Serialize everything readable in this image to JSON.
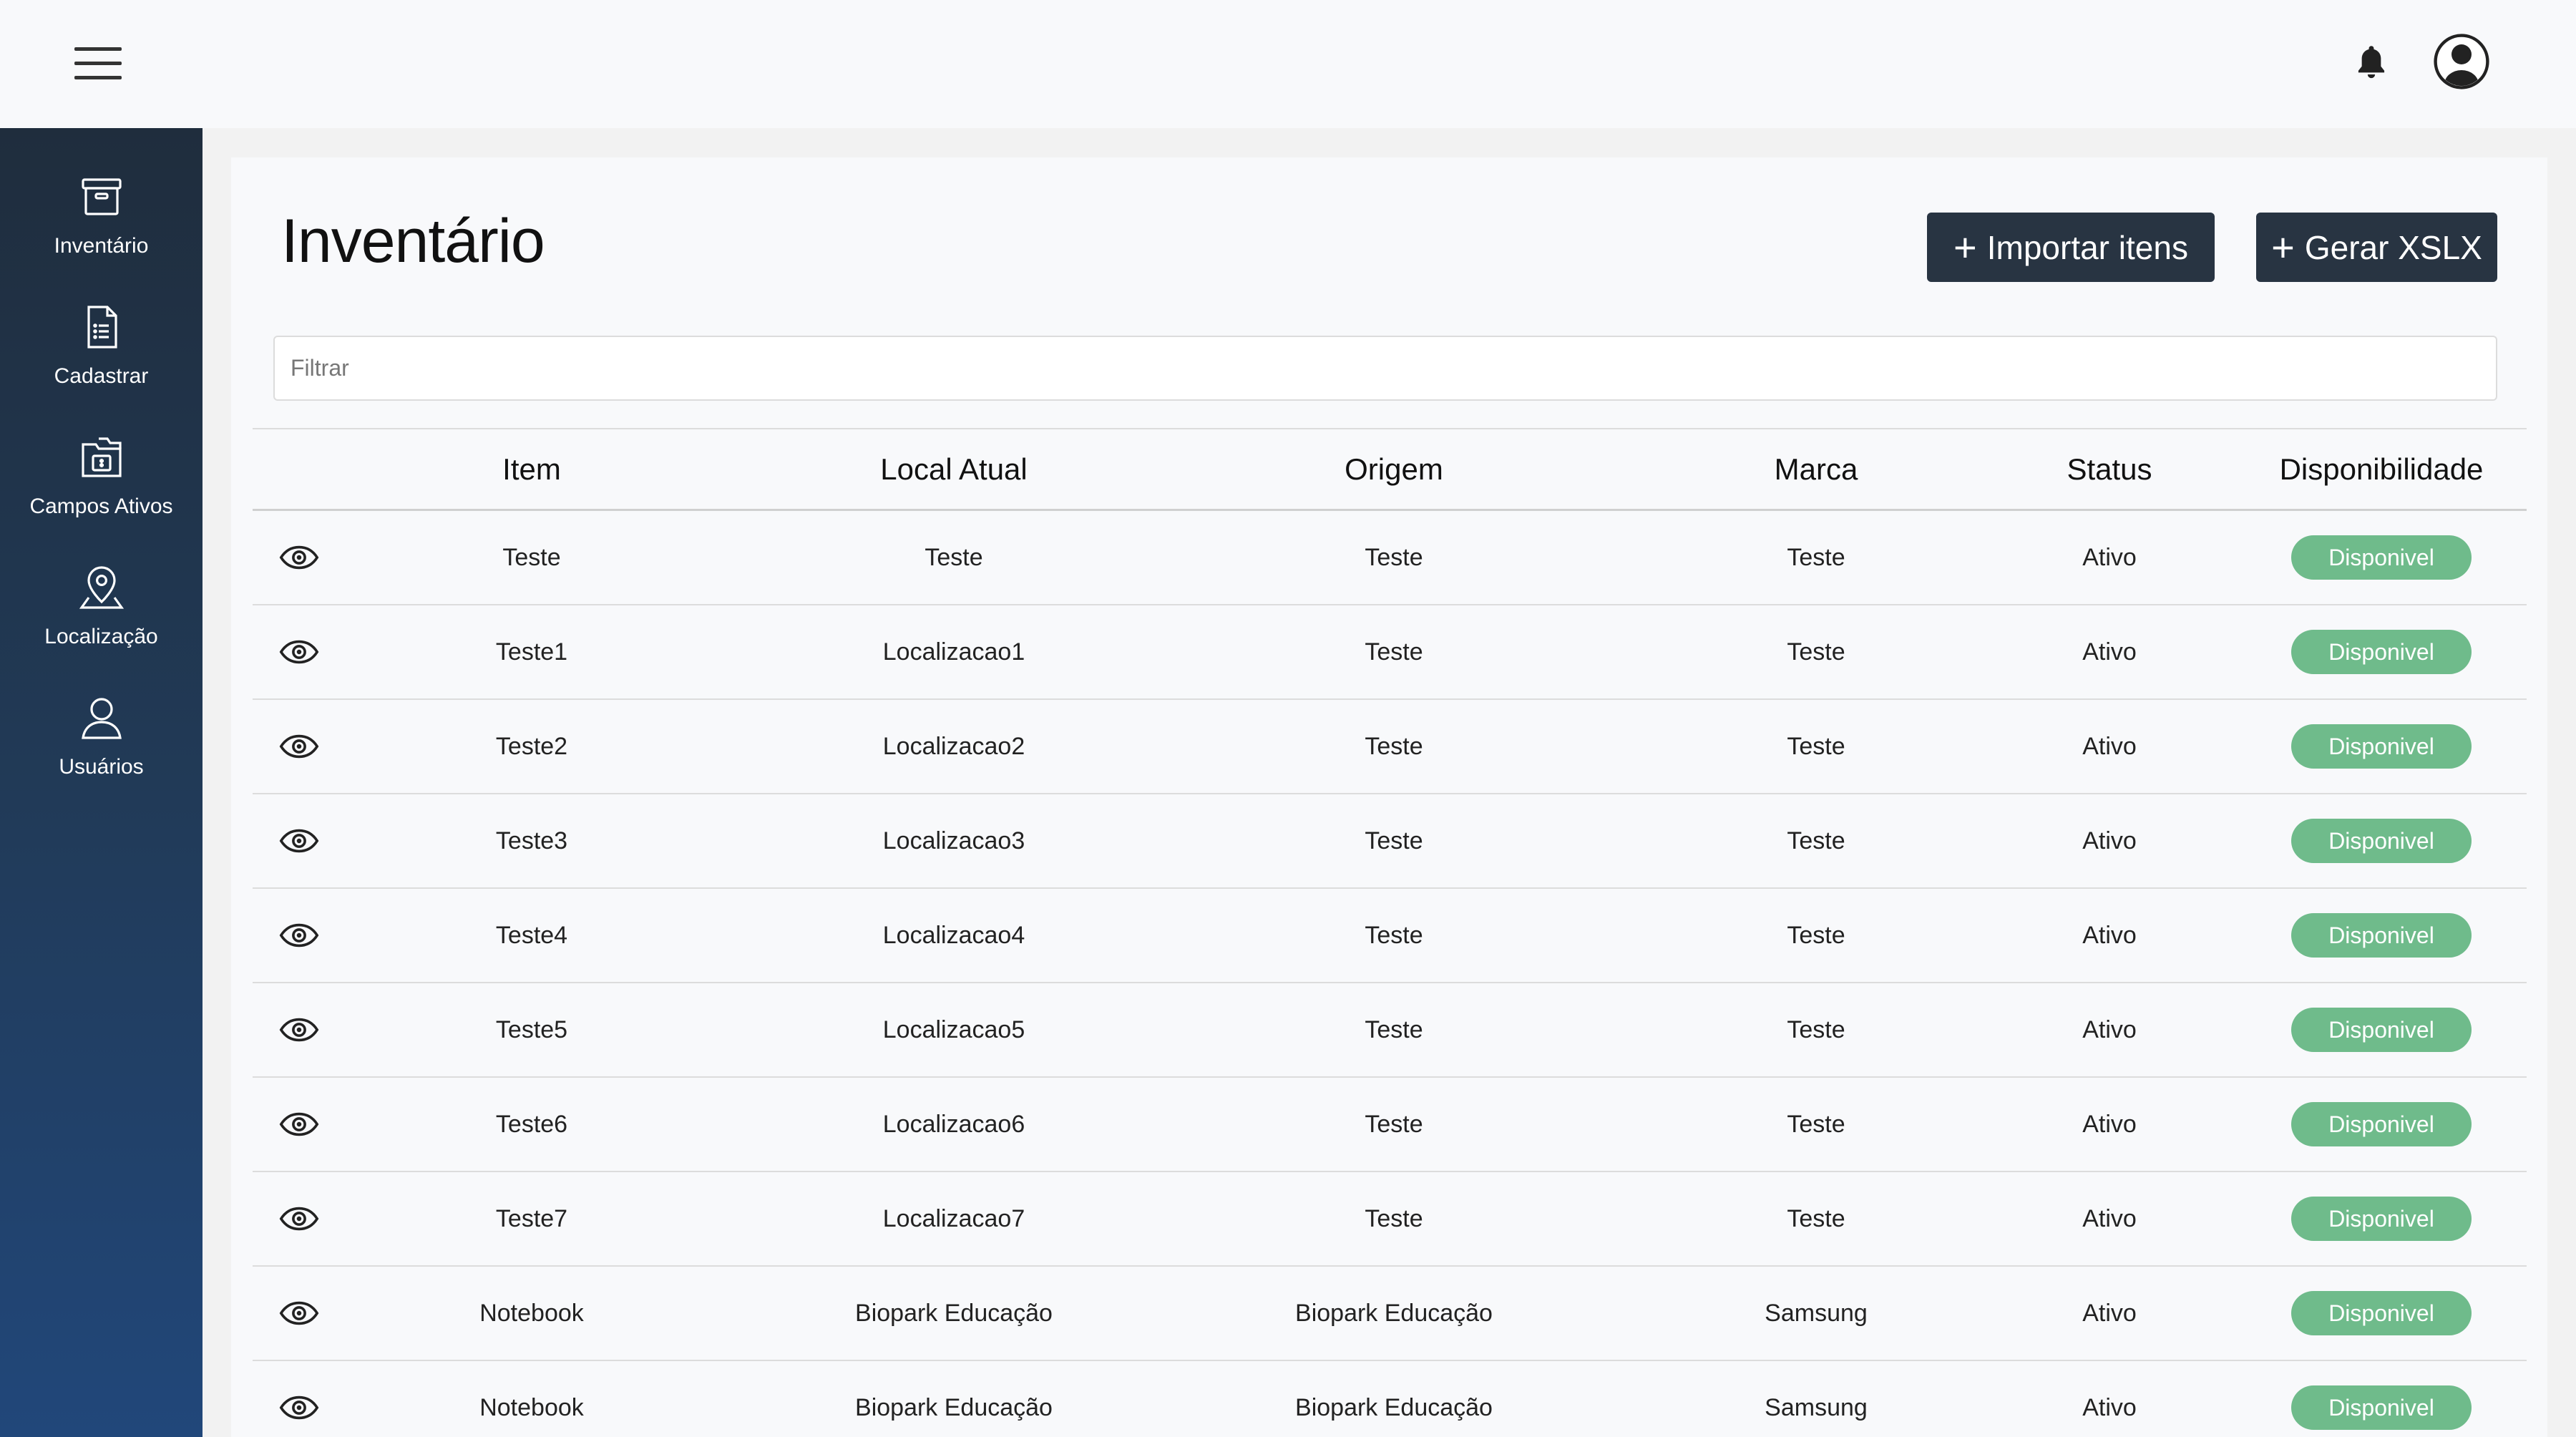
{
  "header": {
    "menu_icon": "hamburger-icon",
    "notification_icon": "bell-icon",
    "avatar_icon": "user-avatar-icon"
  },
  "sidebar": {
    "items": [
      {
        "label": "Inventário",
        "icon": "archive-box-icon"
      },
      {
        "label": "Cadastrar",
        "icon": "document-list-icon"
      },
      {
        "label": "Campos Ativos",
        "icon": "folder-dollar-icon"
      },
      {
        "label": "Localização",
        "icon": "map-pin-icon"
      },
      {
        "label": "Usuários",
        "icon": "user-icon"
      }
    ]
  },
  "main": {
    "title": "Inventário",
    "import_button": "Importar itens",
    "xslx_button": "Gerar XSLX",
    "filter_placeholder": "Filtrar"
  },
  "table": {
    "columns": {
      "item": "Item",
      "local": "Local Atual",
      "origem": "Origem",
      "marca": "Marca",
      "status": "Status",
      "disp": "Disponibilidade"
    },
    "rows": [
      {
        "item": "Teste",
        "local": "Teste",
        "origem": "Teste",
        "marca": "Teste",
        "status": "Ativo",
        "disp": "Disponivel"
      },
      {
        "item": "Teste1",
        "local": "Localizacao1",
        "origem": "Teste",
        "marca": "Teste",
        "status": "Ativo",
        "disp": "Disponivel"
      },
      {
        "item": "Teste2",
        "local": "Localizacao2",
        "origem": "Teste",
        "marca": "Teste",
        "status": "Ativo",
        "disp": "Disponivel"
      },
      {
        "item": "Teste3",
        "local": "Localizacao3",
        "origem": "Teste",
        "marca": "Teste",
        "status": "Ativo",
        "disp": "Disponivel"
      },
      {
        "item": "Teste4",
        "local": "Localizacao4",
        "origem": "Teste",
        "marca": "Teste",
        "status": "Ativo",
        "disp": "Disponivel"
      },
      {
        "item": "Teste5",
        "local": "Localizacao5",
        "origem": "Teste",
        "marca": "Teste",
        "status": "Ativo",
        "disp": "Disponivel"
      },
      {
        "item": "Teste6",
        "local": "Localizacao6",
        "origem": "Teste",
        "marca": "Teste",
        "status": "Ativo",
        "disp": "Disponivel"
      },
      {
        "item": "Teste7",
        "local": "Localizacao7",
        "origem": "Teste",
        "marca": "Teste",
        "status": "Ativo",
        "disp": "Disponivel"
      },
      {
        "item": "Notebook",
        "local": "Biopark Educação",
        "origem": "Biopark Educação",
        "marca": "Samsung",
        "status": "Ativo",
        "disp": "Disponivel"
      },
      {
        "item": "Notebook",
        "local": "Biopark Educação",
        "origem": "Biopark Educação",
        "marca": "Samsung",
        "status": "Ativo",
        "disp": "Disponivel"
      }
    ]
  },
  "colors": {
    "sidebar_top": "#1f2d3d",
    "sidebar_bottom": "#21477a",
    "button": "#283442",
    "badge": "#6fbb8b"
  }
}
